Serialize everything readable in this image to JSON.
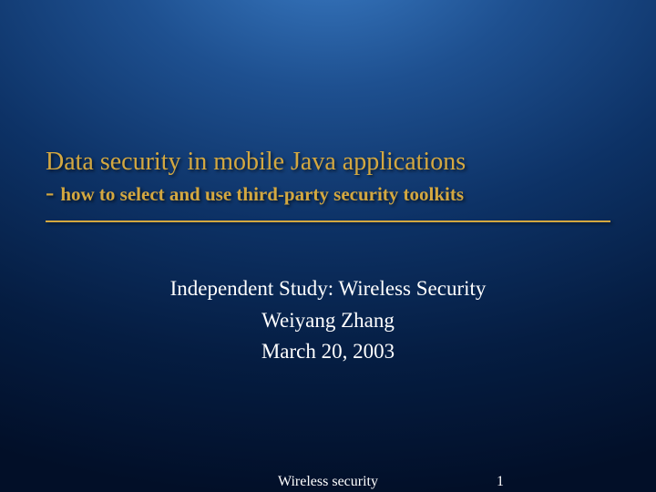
{
  "title": {
    "main": "Data security in mobile Java applications",
    "dash": "- ",
    "sub": "how to select and use third-party security toolkits"
  },
  "body": {
    "line1": "Independent Study: Wireless Security",
    "line2": "Weiyang Zhang",
    "line3": "March 20, 2003"
  },
  "footer": {
    "center": "Wireless security",
    "page": "1"
  }
}
